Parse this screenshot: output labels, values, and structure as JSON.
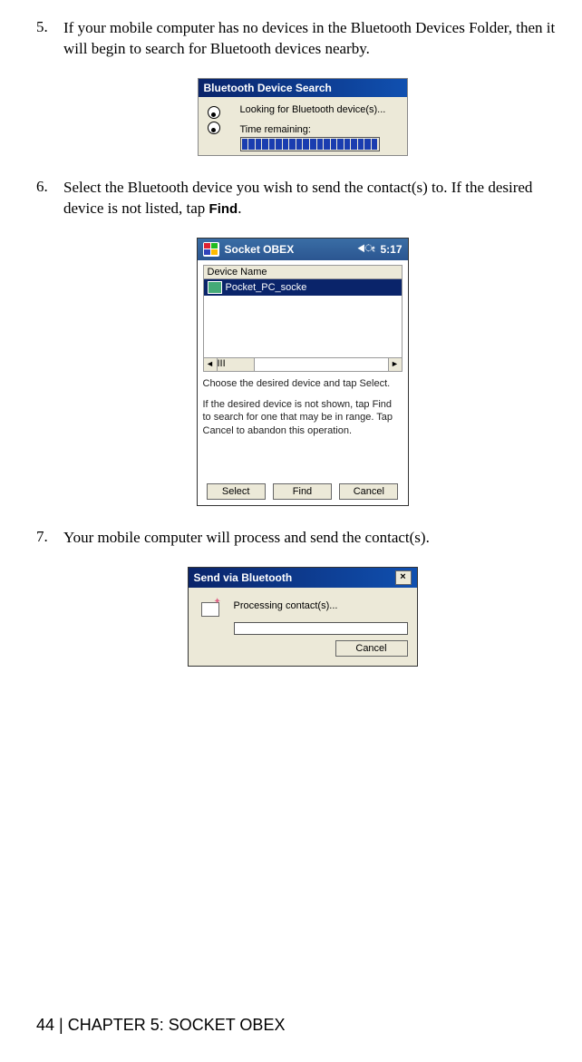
{
  "steps": {
    "s5": {
      "num": "5.",
      "text_a": "If your mobile computer has no devices in the Bluetooth Devices Folder, then it will begin to search for Bluetooth devices nearby."
    },
    "s6": {
      "num": "6.",
      "text_a": "Select the Bluetooth device you wish to send the contact(s) to. If the desired device is not listed, tap ",
      "find": "Find",
      "text_b": "."
    },
    "s7": {
      "num": "7.",
      "text_a": "Your mobile computer will process and send the contact(s)."
    }
  },
  "win1": {
    "title": "Bluetooth Device Search",
    "looking": "Looking for Bluetooth device(s)...",
    "remaining": "Time remaining:"
  },
  "win2": {
    "title": "Socket OBEX",
    "time": "5:17",
    "header": "Device Name",
    "device": "Pocket_PC_socke",
    "help1": "Choose the desired device and tap Select.",
    "help2": "If the desired device is not shown, tap Find to search for one that may be in range. Tap Cancel to abandon this operation.",
    "btn_select": "Select",
    "btn_find": "Find",
    "btn_cancel": "Cancel",
    "scroll_left": "◄",
    "scroll_right": "►",
    "thumb": "III"
  },
  "win3": {
    "title": "Send via Bluetooth",
    "close": "×",
    "processing": "Processing contact(s)...",
    "btn_cancel": "Cancel"
  },
  "footer": {
    "page": "44",
    "sep": "  |  ",
    "chapter": "CHAPTER 5: SOCKET OBEX"
  }
}
